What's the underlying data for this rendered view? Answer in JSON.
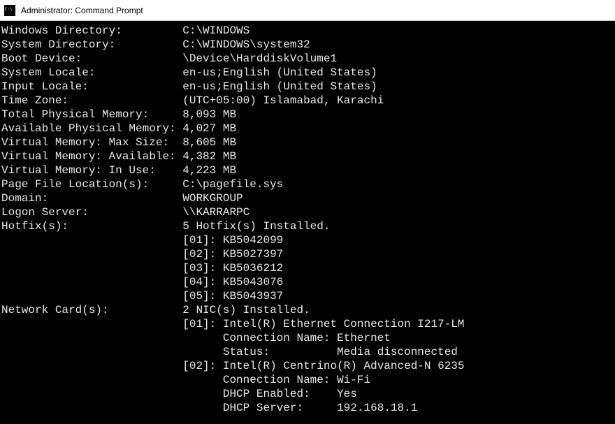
{
  "window": {
    "title": "Administrator: Command Prompt"
  },
  "lines": [
    {
      "label": "Windows Directory:",
      "pad": 27,
      "value": "C:\\WINDOWS"
    },
    {
      "label": "System Directory:",
      "pad": 27,
      "value": "C:\\WINDOWS\\system32"
    },
    {
      "label": "Boot Device:",
      "pad": 27,
      "value": "\\Device\\HarddiskVolume1"
    },
    {
      "label": "System Locale:",
      "pad": 27,
      "value": "en-us;English (United States)"
    },
    {
      "label": "Input Locale:",
      "pad": 27,
      "value": "en-us;English (United States)"
    },
    {
      "label": "Time Zone:",
      "pad": 27,
      "value": "(UTC+05:00) Islamabad, Karachi"
    },
    {
      "label": "Total Physical Memory:",
      "pad": 27,
      "value": "8,093 MB"
    },
    {
      "label": "Available Physical Memory:",
      "pad": 27,
      "value": "4,027 MB"
    },
    {
      "label": "Virtual Memory: Max Size:",
      "pad": 27,
      "value": "8,605 MB"
    },
    {
      "label": "Virtual Memory: Available:",
      "pad": 27,
      "value": "4,382 MB"
    },
    {
      "label": "Virtual Memory: In Use:",
      "pad": 27,
      "value": "4,223 MB"
    },
    {
      "label": "Page File Location(s):",
      "pad": 27,
      "value": "C:\\pagefile.sys"
    },
    {
      "label": "Domain:",
      "pad": 27,
      "value": "WORKGROUP"
    },
    {
      "label": "Logon Server:",
      "pad": 27,
      "value": "\\\\KARRARPC"
    },
    {
      "label": "Hotfix(s):",
      "pad": 27,
      "value": "5 Hotfix(s) Installed."
    },
    {
      "label": "",
      "pad": 27,
      "value": "[01]: KB5042099"
    },
    {
      "label": "",
      "pad": 27,
      "value": "[02]: KB5027397"
    },
    {
      "label": "",
      "pad": 27,
      "value": "[03]: KB5036212"
    },
    {
      "label": "",
      "pad": 27,
      "value": "[04]: KB5043076"
    },
    {
      "label": "",
      "pad": 27,
      "value": "[05]: KB5043937"
    },
    {
      "label": "Network Card(s):",
      "pad": 27,
      "value": "2 NIC(s) Installed."
    },
    {
      "label": "",
      "pad": 27,
      "value": "[01]: Intel(R) Ethernet Connection I217-LM"
    },
    {
      "label": "",
      "pad": 33,
      "value": "Connection Name: Ethernet"
    },
    {
      "label": "",
      "pad": 33,
      "value": "Status:          Media disconnected"
    },
    {
      "label": "",
      "pad": 27,
      "value": "[02]: Intel(R) Centrino(R) Advanced-N 6235"
    },
    {
      "label": "",
      "pad": 33,
      "value": "Connection Name: Wi-Fi"
    },
    {
      "label": "",
      "pad": 33,
      "value": "DHCP Enabled:    Yes"
    },
    {
      "label": "",
      "pad": 33,
      "value": "DHCP Server:     192.168.18.1"
    }
  ]
}
